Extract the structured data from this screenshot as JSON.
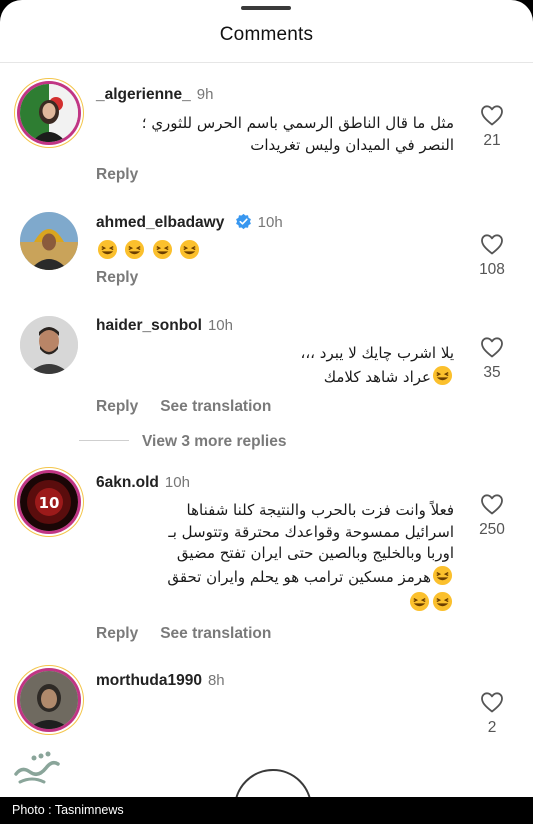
{
  "header": {
    "title": "Comments"
  },
  "comments": [
    {
      "username": "_algerienne_",
      "time": "9h",
      "text_line1": "مثل ما قال الناطق الرسمي باسم الحرس للثوري ؛",
      "text_line2": "النصر في الميدان وليس تغريدات",
      "reply": "Reply",
      "likes": "21"
    },
    {
      "username": "ahmed_elbadawy",
      "time": "10h",
      "verified": true,
      "reply": "Reply",
      "likes": "108",
      "emoji_count": 4
    },
    {
      "username": "haider_sonbol",
      "time": "10h",
      "text_line1": "يلا اشرب چايك لا يبرد ،،،",
      "text_line2": "عراد شاهد كلامك",
      "reply": "Reply",
      "see_translation": "See translation",
      "likes": "35"
    },
    {
      "username": "6akn.old",
      "time": "10h",
      "text_line1": "فعلاً وانت فزت بالحرب والنتيجة كلنا شفناها",
      "text_line2": "اسرائيل ممسوحة وقواعدك محترقة وتتوسل بـ",
      "text_line3": "اوربا وبالخليج وبالصين حتى ايران تفتح مضيق",
      "text_line4": "هرمز مسكين ترامب هو يحلم وايران تحقق",
      "reply": "Reply",
      "see_translation": "See translation",
      "likes": "250"
    },
    {
      "username": "morthuda1990",
      "time": "8h",
      "likes": "2"
    }
  ],
  "view_more_replies": "View 3 more replies",
  "footer": {
    "caption": "Photo : Tasnimnews"
  },
  "colors": {
    "accent_verified": "#3897f0",
    "story_ring": "#c13584",
    "text_muted": "#7a7a7a"
  }
}
